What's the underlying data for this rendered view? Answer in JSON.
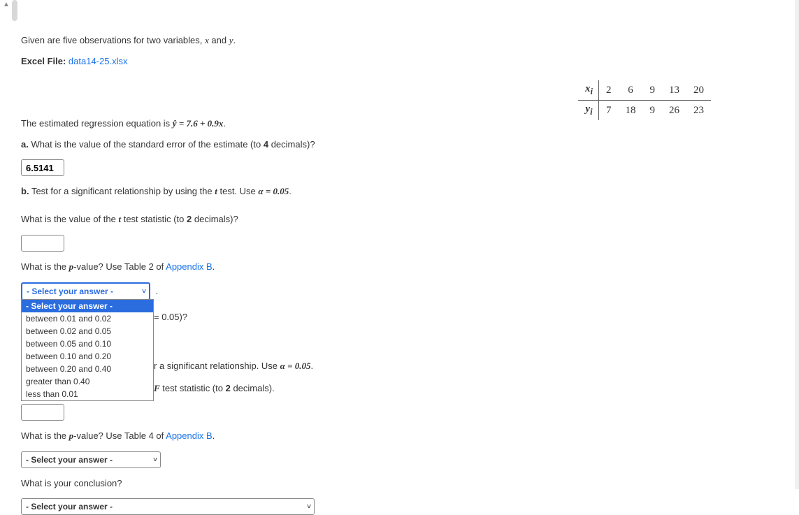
{
  "intro": {
    "text_prefix": "Given are five observations for two variables, ",
    "var1": "x",
    "and": " and ",
    "var2": "y",
    "period": "."
  },
  "excel": {
    "label": "Excel File: ",
    "filename": "data14-25.xlsx"
  },
  "table": {
    "row_x_label": "x_i",
    "row_x": [
      "2",
      "6",
      "9",
      "13",
      "20"
    ],
    "row_y_label": "y_i",
    "row_y": [
      "7",
      "18",
      "9",
      "26",
      "23"
    ]
  },
  "regression": {
    "prefix": "The estimated regression equation is ",
    "equation": "ŷ = 7.6 + 0.9x",
    "suffix": "."
  },
  "part_a": {
    "label": "a.",
    "text": " What is the value of the standard error of the estimate (to ",
    "decimals": "4",
    "suffix": " decimals)?",
    "value": "6.5141"
  },
  "part_b": {
    "label": "b.",
    "text": " Test for a significant relationship by using the ",
    "t": "t",
    "text2": " test. Use ",
    "alpha": "α = 0.05",
    "suffix": "."
  },
  "q_tstat": {
    "prefix": "What is the value of the ",
    "t": "t",
    "mid": " test statistic (to ",
    "decimals": "2",
    "suffix": " decimals)?"
  },
  "q_pvalue1": {
    "prefix": "What is the ",
    "p": "p",
    "mid": "-value? Use Table 2 of ",
    "appendix": "Appendix B",
    "suffix": "."
  },
  "dropdown1": {
    "placeholder": "- Select your answer -",
    "options": [
      "- Select your answer -",
      "between 0.01 and 0.02",
      "between 0.02 and 0.05",
      "between 0.05 and 0.10",
      "between 0.10 and 0.20",
      "between 0.20 and 0.40",
      "greater than 0.40",
      "less than 0.01"
    ],
    "selected_index": 0
  },
  "obscured": {
    "frag1": " = 0.05)?",
    "frag2": "r a significant relationship. Use ",
    "frag2_alpha": "α = 0.05",
    "frag2_suffix": ".",
    "frag3_pre": " test statistic (to ",
    "frag3_dec": "2",
    "frag3_suf": " decimals)."
  },
  "dot_after_select": ".",
  "q_pvalue2": {
    "prefix": "What is the ",
    "p": "p",
    "mid": "-value? Use Table 4 of ",
    "appendix": "Appendix B",
    "suffix": "."
  },
  "dropdown2": {
    "placeholder": "- Select your answer -"
  },
  "q_conclusion": "What is your conclusion?",
  "dropdown3": {
    "placeholder": "- Select your answer -"
  },
  "icons": {
    "caret": "˅",
    "scroll_up": "▲"
  }
}
